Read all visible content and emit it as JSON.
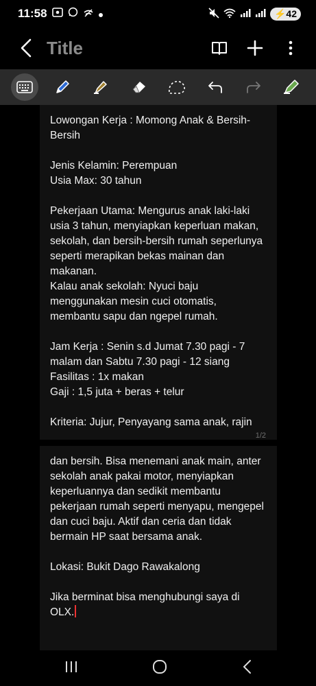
{
  "status": {
    "time": "11:58",
    "battery": "42"
  },
  "appbar": {
    "title": "Title"
  },
  "note": {
    "page1_text": "Lowongan Kerja : Momong Anak & Bersih-Bersih\n\nJenis Kelamin: Perempuan\nUsia Max: 30 tahun\n\nPekerjaan Utama: Mengurus anak laki-laki usia 3 tahun, menyiapkan keperluan makan, sekolah, dan bersih-bersih rumah seperlunya seperti merapikan bekas mainan dan makanan.\nKalau anak sekolah: Nyuci baju menggunakan mesin cuci otomatis, membantu sapu dan ngepel rumah.\n\nJam Kerja : Senin s.d Jumat 7.30 pagi - 7 malam dan Sabtu 7.30 pagi - 12 siang\nFasilitas : 1x makan\nGaji : 1,5 juta + beras + telur\n\nKriteria: Jujur, Penyayang sama anak, rajin",
    "page1_number": "1/2",
    "page2_text": "dan bersih. Bisa menemani anak main, anter sekolah anak pakai motor, menyiapkan keperluannya dan sedikit membantu pekerjaan rumah seperti menyapu, mengepel dan cuci baju. Aktif dan ceria dan tidak bermain HP saat bersama anak.\n\nLokasi: Bukit Dago Rawakalong\n\nJika berminat bisa menghubungi saya di OLX."
  },
  "icons": {
    "toolbar": [
      "keyboard-icon",
      "pen-icon",
      "highlighter-icon",
      "eraser-icon",
      "lasso-icon",
      "undo-icon",
      "redo-icon",
      "pen-settings-icon"
    ],
    "appbar": [
      "back-icon",
      "reading-mode-icon",
      "add-icon",
      "more-options-icon"
    ],
    "navbar": [
      "recents-icon",
      "home-icon",
      "back-icon"
    ]
  },
  "colors": {
    "background": "#000000",
    "toolbar": "#2a2a2a",
    "page": "#111111",
    "title": "#8a8a8a",
    "cursor": "#ee3333"
  }
}
